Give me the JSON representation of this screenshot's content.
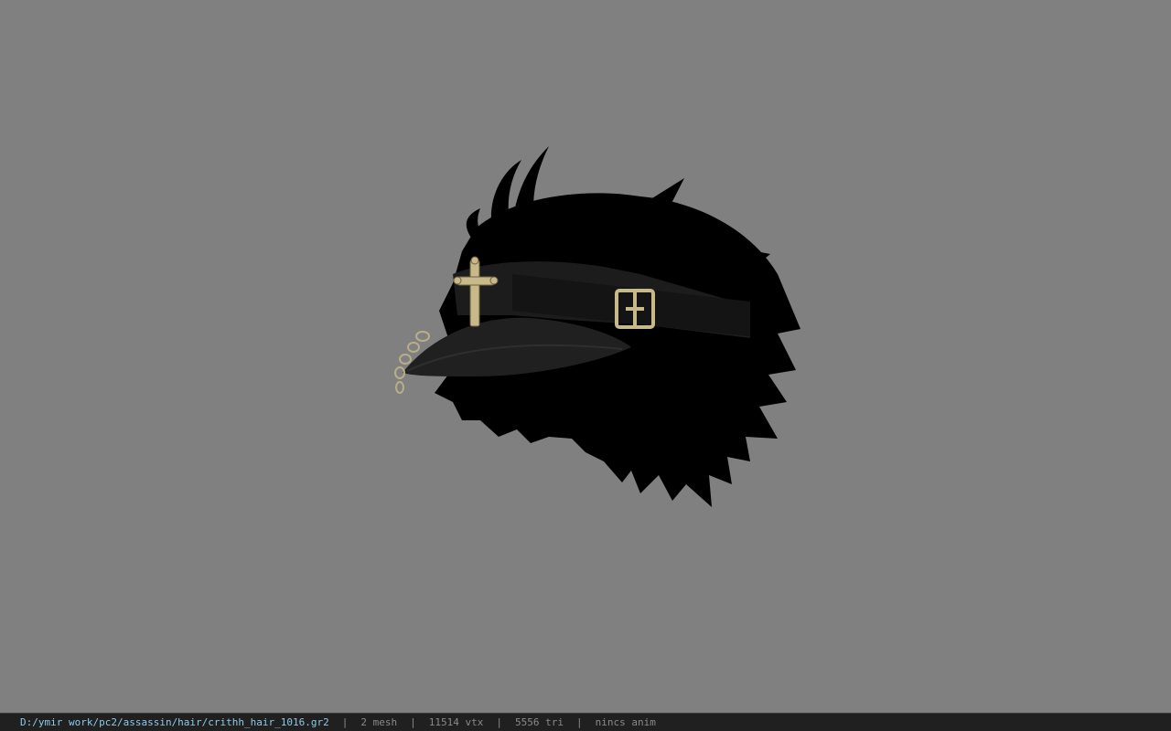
{
  "viewport": {
    "background": "#808080",
    "model": {
      "subject": "black spiky hair with black cap",
      "hair_color": "#000000",
      "cap_color": "#1c1c1c",
      "ornament_color": "#c8b98a",
      "ornaments": [
        "cross-icon",
        "buckle-icon",
        "chain-icon"
      ]
    }
  },
  "status_bar": {
    "file_path": "D:/ymir work/pc2/assassin/hair/crithh_hair_1016.gr2",
    "separator": "|",
    "mesh": "2 mesh",
    "vtx": "11514 vtx",
    "tri": "5556 tri",
    "anim": "nincs anim"
  }
}
